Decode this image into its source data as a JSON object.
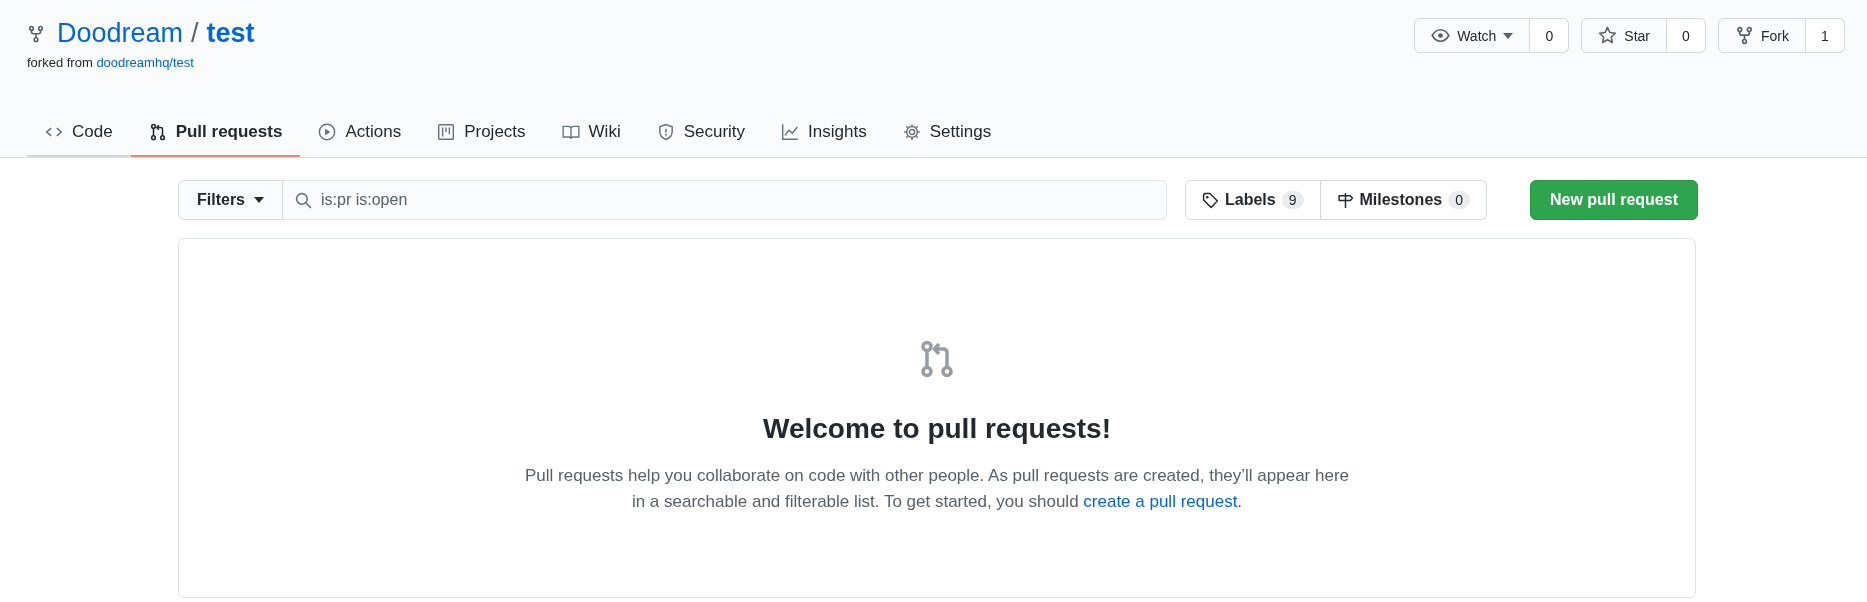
{
  "repo": {
    "owner": "Doodream",
    "separator": "/",
    "name": "test",
    "forked_prefix": "forked from",
    "forked_link": "doodreamhq/test"
  },
  "actions": [
    {
      "kind": "watch",
      "label": "Watch",
      "count": "0",
      "dropdown": true
    },
    {
      "kind": "star",
      "label": "Star",
      "count": "0",
      "dropdown": false
    },
    {
      "kind": "fork",
      "label": "Fork",
      "count": "1",
      "dropdown": false
    }
  ],
  "tabs": [
    {
      "kind": "code",
      "label": "Code",
      "selected": false,
      "hovered": true
    },
    {
      "kind": "pull",
      "label": "Pull requests",
      "selected": true,
      "hovered": false
    },
    {
      "kind": "play",
      "label": "Actions",
      "selected": false,
      "hovered": false
    },
    {
      "kind": "project",
      "label": "Projects",
      "selected": false,
      "hovered": false
    },
    {
      "kind": "book",
      "label": "Wiki",
      "selected": false,
      "hovered": false
    },
    {
      "kind": "shield",
      "label": "Security",
      "selected": false,
      "hovered": false
    },
    {
      "kind": "graph",
      "label": "Insights",
      "selected": false,
      "hovered": false
    },
    {
      "kind": "gear",
      "label": "Settings",
      "selected": false,
      "hovered": false
    }
  ],
  "toolbar": {
    "filters": "Filters",
    "search": {
      "value": "is:pr is:open"
    },
    "labels": {
      "label": "Labels",
      "count": "9"
    },
    "milestones": {
      "label": "Milestones",
      "count": "0"
    },
    "new_button": "New pull request"
  },
  "blankslate": {
    "title": "Welcome to pull requests!",
    "text_before": "Pull requests help you collaborate on code with other people. As pull requests are created, they’ll appear here in a searchable and filterable list. To get started, you should ",
    "link": "create a pull request",
    "text_after": "."
  }
}
